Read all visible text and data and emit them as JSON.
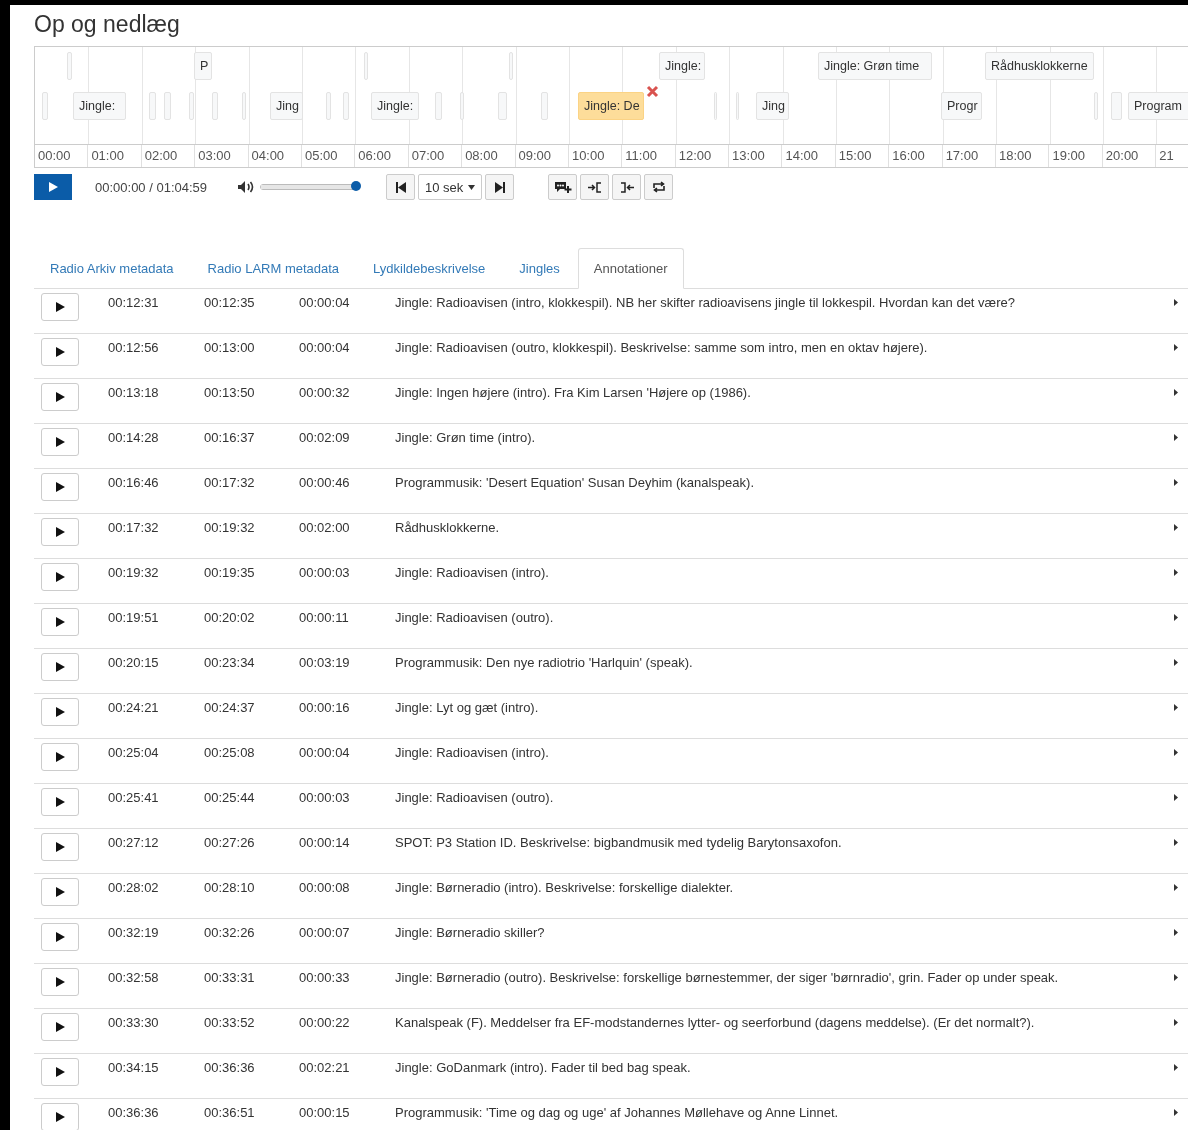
{
  "title": "Op og nedlæg",
  "timeline": {
    "segments": [
      {
        "label": "P",
        "selected": false
      },
      {
        "label": "Jingle:",
        "selected": false
      },
      {
        "label": "Jingle: Grøn time",
        "selected": false
      },
      {
        "label": "Rådhusklokkerne",
        "selected": false
      },
      {
        "label": "Jingle:",
        "selected": false
      },
      {
        "label": "Jing",
        "selected": false
      },
      {
        "label": "Jingle:",
        "selected": false
      },
      {
        "label": "Jingle: De",
        "selected": true
      },
      {
        "label": "Jing",
        "selected": false
      },
      {
        "label": "Progr",
        "selected": false
      },
      {
        "label": "Program",
        "selected": false
      }
    ],
    "ticks": [
      "00:00",
      "01:00",
      "02:00",
      "03:00",
      "04:00",
      "05:00",
      "06:00",
      "07:00",
      "08:00",
      "09:00",
      "10:00",
      "11:00",
      "12:00",
      "13:00",
      "14:00",
      "15:00",
      "16:00",
      "17:00",
      "18:00",
      "19:00",
      "20:00",
      "21"
    ]
  },
  "player": {
    "time": "00:00:00 / 01:04:59",
    "volume": {
      "level": 1
    },
    "step": "10 sek"
  },
  "tabs": [
    {
      "label": "Radio Arkiv metadata",
      "selected": false
    },
    {
      "label": "Radio LARM metadata",
      "selected": false
    },
    {
      "label": "Lydkildebeskrivelse",
      "selected": false
    },
    {
      "label": "Jingles",
      "selected": false
    },
    {
      "label": "Annotationer",
      "selected": true
    }
  ],
  "annotations": [
    {
      "start": "00:12:31",
      "end": "00:12:35",
      "duration": "00:00:04",
      "text": "Jingle: Radioavisen (intro, klokkespil). NB her skifter radioavisens jingle til lokkespil. Hvordan kan det være?"
    },
    {
      "start": "00:12:56",
      "end": "00:13:00",
      "duration": "00:00:04",
      "text": "Jingle: Radioavisen (outro, klokkespil). Beskrivelse: samme som intro, men en oktav højere)."
    },
    {
      "start": "00:13:18",
      "end": "00:13:50",
      "duration": "00:00:32",
      "text": "Jingle: Ingen højere (intro). Fra Kim Larsen 'Højere op (1986)."
    },
    {
      "start": "00:14:28",
      "end": "00:16:37",
      "duration": "00:02:09",
      "text": "Jingle: Grøn time (intro)."
    },
    {
      "start": "00:16:46",
      "end": "00:17:32",
      "duration": "00:00:46",
      "text": "Programmusik: 'Desert Equation' Susan Deyhim (kanalspeak)."
    },
    {
      "start": "00:17:32",
      "end": "00:19:32",
      "duration": "00:02:00",
      "text": "Rådhusklokkerne."
    },
    {
      "start": "00:19:32",
      "end": "00:19:35",
      "duration": "00:00:03",
      "text": "Jingle: Radioavisen (intro)."
    },
    {
      "start": "00:19:51",
      "end": "00:20:02",
      "duration": "00:00:11",
      "text": "Jingle: Radioavisen (outro)."
    },
    {
      "start": "00:20:15",
      "end": "00:23:34",
      "duration": "00:03:19",
      "text": "Programmusik: Den nye radiotrio 'Harlquin' (speak)."
    },
    {
      "start": "00:24:21",
      "end": "00:24:37",
      "duration": "00:00:16",
      "text": "Jingle: Lyt og gæt (intro)."
    },
    {
      "start": "00:25:04",
      "end": "00:25:08",
      "duration": "00:00:04",
      "text": "Jingle: Radioavisen (intro)."
    },
    {
      "start": "00:25:41",
      "end": "00:25:44",
      "duration": "00:00:03",
      "text": "Jingle: Radioavisen (outro)."
    },
    {
      "start": "00:27:12",
      "end": "00:27:26",
      "duration": "00:00:14",
      "text": "SPOT: P3 Station ID. Beskrivelse: bigbandmusik med tydelig Barytonsaxofon."
    },
    {
      "start": "00:28:02",
      "end": "00:28:10",
      "duration": "00:00:08",
      "text": "Jingle: Børneradio (intro). Beskrivelse: forskellige dialekter."
    },
    {
      "start": "00:32:19",
      "end": "00:32:26",
      "duration": "00:00:07",
      "text": "Jingle: Børneradio skiller?"
    },
    {
      "start": "00:32:58",
      "end": "00:33:31",
      "duration": "00:00:33",
      "text": "Jingle: Børneradio (outro). Beskrivelse: forskellige børnestemmer, der siger 'børnradio', grin. Fader op under speak."
    },
    {
      "start": "00:33:30",
      "end": "00:33:52",
      "duration": "00:00:22",
      "text": "Kanalspeak (F). Meddelser fra EF-modstandernes lytter- og seerforbund (dagens meddelse). (Er det normalt?)."
    },
    {
      "start": "00:34:15",
      "end": "00:36:36",
      "duration": "00:02:21",
      "text": "Jingle: GoDanmark (intro). Fader til bed bag speak."
    },
    {
      "start": "00:36:36",
      "end": "00:36:51",
      "duration": "00:00:15",
      "text": "Programmusik: 'Time og dag og uge' af Johannes Møllehave og Anne Linnet."
    }
  ]
}
